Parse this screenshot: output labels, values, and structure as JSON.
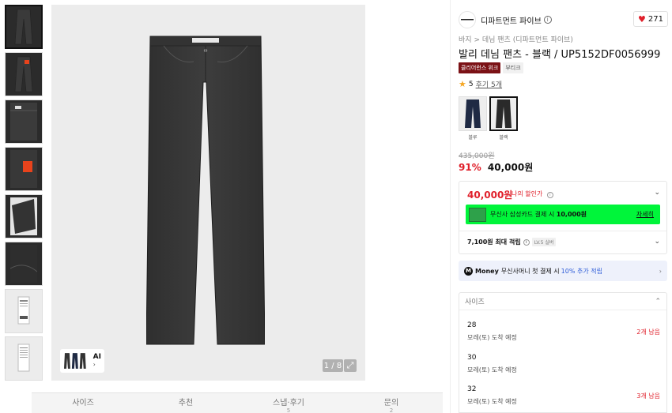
{
  "gallery": {
    "counter": "1 / 8",
    "ai_label": "AI",
    "expand_icon": "expand-icon"
  },
  "tabs": [
    {
      "label": "사이즈",
      "sub": ""
    },
    {
      "label": "추천",
      "sub": ""
    },
    {
      "label": "스냅·후기",
      "sub": "5"
    },
    {
      "label": "문의",
      "sub": "2"
    }
  ],
  "brand": {
    "logo_text": "DEPARTMENT5",
    "name": "디파트먼트 파이브",
    "likes": "271"
  },
  "breadcrumb": {
    "category": "바지",
    "separator": ">",
    "sub": "데님 팬츠 (디파트먼트 파이브)"
  },
  "product": {
    "title": "발리 데님 팬츠 - 블랙 / UP5152DF0056999",
    "badge_red": "클리어런스 위크",
    "badge_gray": "부티크",
    "rating": "5",
    "review": "후기 5개"
  },
  "colors": [
    {
      "label": "블루",
      "swatch": "#1f2a44"
    },
    {
      "label": "블랙",
      "swatch": "#2a2a2a"
    }
  ],
  "price": {
    "original": "435,000원",
    "discount": "91%",
    "sale": "40,000원"
  },
  "benefit": {
    "my_price": "40,000원",
    "my_price_label": "나의 할인가",
    "card_text_pre": "무신사 삼성카드 결제 시",
    "card_text_amount": "10,000원",
    "card_more": "자세히",
    "points": "7,100원 최대 적립",
    "level": "LV.5 실버"
  },
  "money": {
    "icon": "M",
    "brand": "Money",
    "text_pre": "무신사머니 첫 결제 시",
    "text_blue": "10% 추가 적립"
  },
  "size": {
    "header": "사이즈",
    "items": [
      {
        "size": "28",
        "ship": "모레(토) 도착 예정",
        "stock": "2개 남음"
      },
      {
        "size": "30",
        "ship": "모레(토) 도착 예정",
        "stock": ""
      },
      {
        "size": "32",
        "ship": "모레(토) 도착 예정",
        "stock": "3개 남음"
      }
    ]
  },
  "colors_accent": {
    "sale_red": "#e0202b",
    "card_green": "#00f53a",
    "money_blue": "#2f5dd8"
  }
}
